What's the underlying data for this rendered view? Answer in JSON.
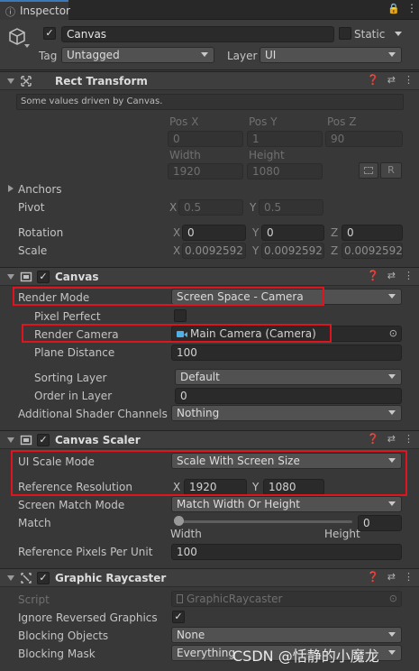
{
  "tab": {
    "title": "Inspector"
  },
  "object": {
    "name": "Canvas",
    "static_label": "Static",
    "tag_label": "Tag",
    "tag_value": "Untagged",
    "layer_label": "Layer",
    "layer_value": "UI"
  },
  "rect_transform": {
    "title": "Rect Transform",
    "notice": "Some values driven by Canvas.",
    "pos_x_label": "Pos X",
    "pos_y_label": "Pos Y",
    "pos_z_label": "Pos Z",
    "pos_x": "0",
    "pos_y": "1",
    "pos_z": "90",
    "width_label": "Width",
    "height_label": "Height",
    "width": "1920",
    "height": "1080",
    "r_button": "R",
    "anchors_label": "Anchors",
    "pivot_label": "Pivot",
    "pivot_x": "0.5",
    "pivot_y": "0.5",
    "rotation_label": "Rotation",
    "rot_x": "0",
    "rot_y": "0",
    "rot_z": "0",
    "scale_label": "Scale",
    "scale_x": "0.0092592",
    "scale_y": "0.0092592",
    "scale_z": "0.0092592",
    "x": "X",
    "y": "Y",
    "z": "Z"
  },
  "canvas": {
    "title": "Canvas",
    "render_mode_label": "Render Mode",
    "render_mode_value": "Screen Space - Camera",
    "pixel_perfect_label": "Pixel Perfect",
    "render_camera_label": "Render Camera",
    "render_camera_value": "Main Camera (Camera)",
    "plane_distance_label": "Plane Distance",
    "plane_distance_value": "100",
    "sorting_layer_label": "Sorting Layer",
    "sorting_layer_value": "Default",
    "order_in_layer_label": "Order in Layer",
    "order_in_layer_value": "0",
    "shader_channels_label": "Additional Shader Channels",
    "shader_channels_value": "Nothing"
  },
  "canvas_scaler": {
    "title": "Canvas Scaler",
    "ui_scale_mode_label": "UI Scale Mode",
    "ui_scale_mode_value": "Scale With Screen Size",
    "ref_res_label": "Reference Resolution",
    "x": "X",
    "y": "Y",
    "ref_x": "1920",
    "ref_y": "1080",
    "match_mode_label": "Screen Match Mode",
    "match_mode_value": "Match Width Or Height",
    "match_label": "Match",
    "match_value": "0",
    "match_fraction": 0,
    "width_label": "Width",
    "height_label": "Height",
    "ref_ppu_label": "Reference Pixels Per Unit",
    "ref_ppu_value": "100"
  },
  "graphic_raycaster": {
    "title": "Graphic Raycaster",
    "script_label": "Script",
    "script_value": "GraphicRaycaster",
    "ignore_reversed_label": "Ignore Reversed Graphics",
    "ignore_reversed_checked": "✓",
    "blocking_objects_label": "Blocking Objects",
    "blocking_objects_value": "None",
    "blocking_mask_label": "Blocking Mask",
    "blocking_mask_value": "Everything"
  },
  "watermark": "CSDN @恬静的小魔龙",
  "colors": {
    "background": "#383838",
    "header": "#3e3e3e",
    "highlight": "#e0141e",
    "field": "#2a2a2a"
  }
}
